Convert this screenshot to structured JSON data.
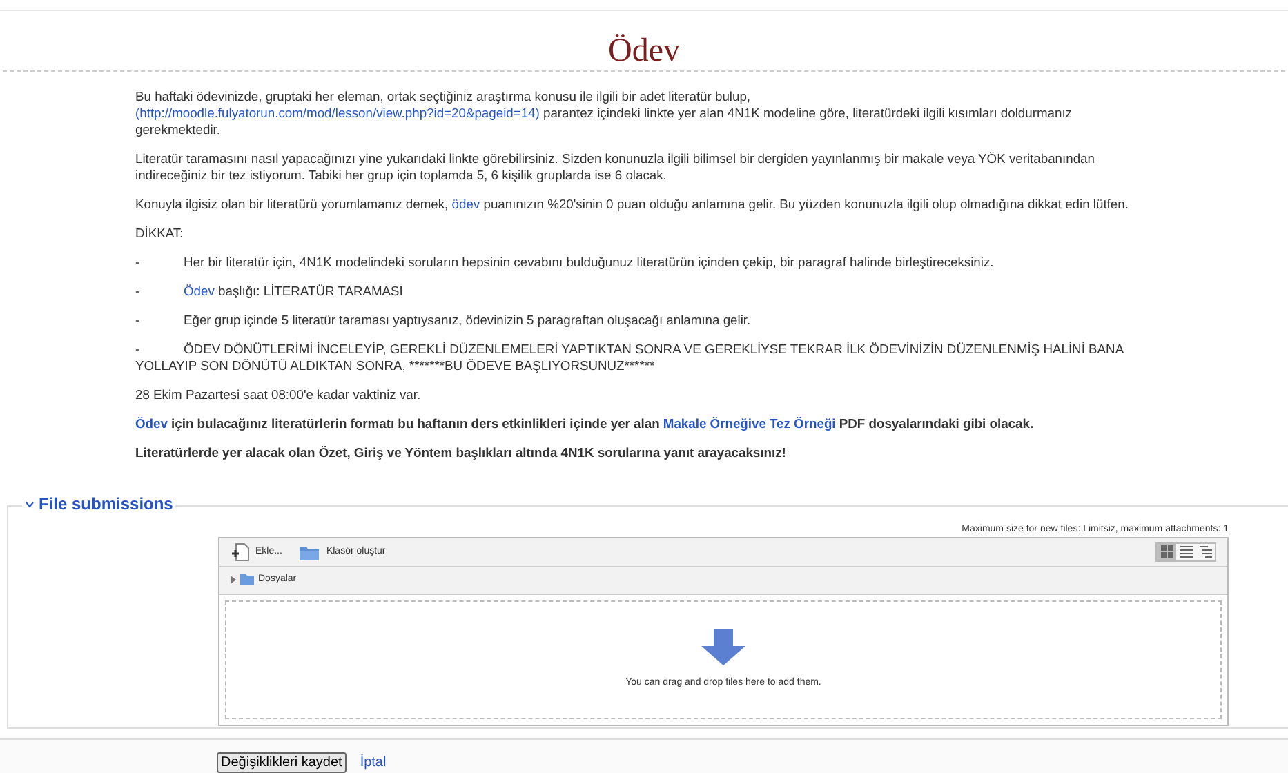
{
  "title": "Ödev",
  "paragraphs": [
    {
      "kind": "text",
      "segments": [
        {
          "text": "Bu haftaki ödevinizde, gruptaki her eleman, ortak seçtiğiniz araştırma konusu ile ilgili bir adet literatür bulup, ",
          "kind": "plain"
        },
        {
          "text": "(http://moodle.fulyatorun.com/mod/lesson/view.php?id=20&pageid=14)",
          "kind": "link"
        },
        {
          "text": " parantez içindeki linkte yer alan 4N1K modeline göre, literatürdeki ilgili kısımları doldurmanız gerekmektedir.",
          "kind": "plain"
        }
      ]
    },
    {
      "kind": "text",
      "segments": [
        {
          "text": "Literatür taramasını nasıl yapacağınızı yine yukarıdaki linkte görebilirsiniz. Sizden konunuzla ilgili bilimsel bir dergiden yayınlanmış bir makale veya YÖK veritabanından indireceğiniz bir tez istiyorum. Tabiki her grup için toplamda 5, 6 kişilik gruplarda ise 6 olacak.",
          "kind": "plain"
        }
      ]
    },
    {
      "kind": "text",
      "segments": [
        {
          "text": "Konuyla ilgisiz olan bir literatürü yorumlamanız demek, ",
          "kind": "plain"
        },
        {
          "text": "ödev",
          "kind": "link"
        },
        {
          "text": " puanınızın %20'sinin 0 puan olduğu anlamına gelir. Bu yüzden konunuzla ilgili olup olmadığına dikkat edin lütfen.",
          "kind": "plain"
        }
      ]
    },
    {
      "kind": "text",
      "segments": [
        {
          "text": "DİKKAT:",
          "kind": "plain"
        }
      ]
    },
    {
      "kind": "bullet",
      "bullet": "-",
      "segments": [
        {
          "text": "Her bir literatür için, 4N1K modelindeki soruların hepsinin cevabını bulduğunuz literatürün içinden çekip, bir paragraf halinde birleştireceksiniz.",
          "kind": "plain"
        }
      ]
    },
    {
      "kind": "bullet",
      "bullet": "-",
      "segments": [
        {
          "text": "Ödev",
          "kind": "link"
        },
        {
          "text": " başlığı: LİTERATÜR TARAMASI",
          "kind": "plain"
        }
      ]
    },
    {
      "kind": "bullet",
      "bullet": "-",
      "segments": [
        {
          "text": "Eğer grup içinde 5 literatür taraması yaptıysanız, ödevinizin 5 paragraftan oluşacağı anlamına gelir.",
          "kind": "plain"
        }
      ]
    },
    {
      "kind": "bullet",
      "bullet": "-",
      "segments": [
        {
          "text": "ÖDEV DÖNÜTLERİMİ İNCELEYİP, GEREKLİ DÜZENLEMELERİ YAPTIKTAN SONRA VE GEREKLİYSE TEKRAR İLK ÖDEVİNİZİN DÜZENLENMİŞ HALİNİ BANA YOLLAYIP SON DÖNÜTÜ ALDIKTAN SONRA, *******BU ÖDEVE BAŞLIYORSUNUZ******",
          "kind": "plain"
        }
      ]
    },
    {
      "kind": "text",
      "segments": [
        {
          "text": "28 Ekim Pazartesi saat 08:00'e kadar vaktiniz var.",
          "kind": "plain"
        }
      ]
    },
    {
      "kind": "bold",
      "segments": [
        {
          "text": "Ödev",
          "kind": "link"
        },
        {
          "text": " için bulacağınız literatürlerin formatı bu haftanın ders etkinlikleri içinde yer alan ",
          "kind": "plain"
        },
        {
          "text": "Makale Örneğive Tez Örneği",
          "kind": "link"
        },
        {
          "text": " PDF dosyalarındaki gibi olacak.",
          "kind": "plain"
        }
      ]
    },
    {
      "kind": "bold",
      "segments": [
        {
          "text": "Literatürlerde yer alacak olan Özet, Giriş ve Yöntem başlıkları altında 4N1K sorularına yanıt arayacaksınız!",
          "kind": "plain"
        }
      ]
    }
  ],
  "file_submissions": {
    "legend": "File submissions",
    "expanded": true,
    "limits": "Maximum size for new files: Limitsiz, maximum attachments: 1",
    "toolbar": [
      {
        "label": "Ekle...",
        "kind": "file"
      },
      {
        "label": "Klasör oluştur",
        "kind": "folder"
      }
    ],
    "views": [
      {
        "kind": "icons",
        "selected": true
      },
      {
        "kind": "list",
        "selected": false
      },
      {
        "kind": "tree",
        "selected": false
      }
    ],
    "path": "Dosyalar",
    "drop_hint": "You can drag and drop files here to add them."
  },
  "buttons": {
    "save": "Değişiklikleri kaydet",
    "cancel": "İptal"
  }
}
